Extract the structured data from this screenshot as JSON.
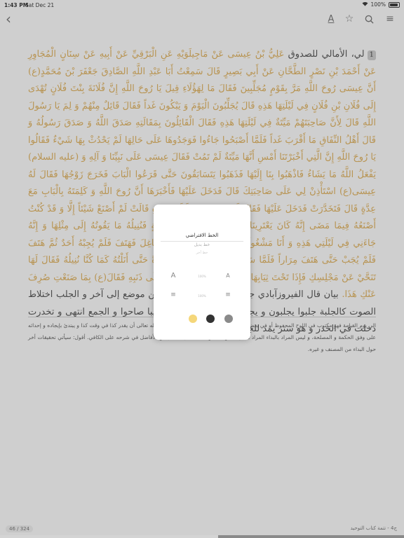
{
  "status_bar": {
    "time": "1:43 PM",
    "date": "Sat Dec 21",
    "battery": "100%"
  },
  "toolbar": {
    "back": "‹",
    "font": "A",
    "bookmark": "☆",
    "search": "⌕",
    "menu": "≡"
  },
  "content": {
    "marker": "1",
    "intro": "لي، الأمالي للصدوق ",
    "quote": "عَلِيُّ بْنُ عِيسَى عَنْ مَاجِيلَوَيْهِ عَنِ الْبَرْقِيِّ عَنْ أَبِيهِ عَنْ سِنَانٍ الْمُجَاوِرِ عَنْ أَحْمَدَ بْنِ نَصْرٍ الطَّحَّانِ عَنْ أَبِي بَصِيرٍ قَالَ سَمِعْتُ أَبَا عَبْدِ اللَّهِ الصَّادِقَ جَعْفَرَ بْنَ مُحَمَّدٍ(ع) أَنَّ عِيسَى رُوحَ اللَّهِ مَرَّ بِقَوْمٍ مُجَلِّبِينَ فَقَالَ مَا لِهَؤُلَاءِ قِيلَ يَا رُوحَ اللَّهِ إِنَّ فُلَانَةَ بِنْتَ فُلَانٍ تُهْدَى إِلَى فُلَانِ بْنِ فُلَانٍ فِي لَيْلَتِهَا هَذِهِ قَالَ يُجَلِّبُونَ الْيَوْمَ وَ يَبْكُونَ غَداً فَقَالَ قَائِلٌ مِنْهُمْ وَ لِمَ يَا رَسُولَ اللَّهِ قَالَ لِأَنَّ صَاحِبَتَهُمْ مَيِّتَةٌ فِي لَيْلَتِهَا هَذِهِ فَقَالَ الْقَائِلُونَ بِمَقَالَتِهِ صَدَقَ اللَّهُ وَ صَدَقَ رَسُولُهُ وَ قَالَ أَهْلُ النِّفَاقِ مَا أَقْرَبَ غَداً فَلَمَّا أَصْبَحُوا جَاءُوا فَوَجَدُوهَا عَلَى حَالِهَا لَمْ يَحْدُثْ بِهَا شَيْءٌ فَقَالُوا يَا رُوحَ اللَّهِ إِنَّ الَّتِي أَخْبَرْتَنَا أَمْسِ أَنَّهَا مَيِّتَةٌ لَمْ تَمُتْ فَقَالَ عِيسَى عَلَى نَبِيِّنَا وَ آلِهِ وَ (عليه السلام) يَفْعَلُ اللَّهُ مَا يَشَاءُ فَاذْهَبُوا بِنَا إِلَيْهَا فَذَهَبُوا يَتَسَابَقُونَ حَتَّى قَرَعُوا الْبَابَ فَخَرَجَ زَوْجُهَا فَقَالَ لَهُ عِيسَى(ع) اسْتَأْذِنْ لِي عَلَى صَاحِبَتِكَ قَالَ فَدَخَلَ عَلَيْهَا فَأَخْبَرَهَا أَنَّ رُوحَ اللَّهِ وَ كَلِمَتَهُ بِالْبَابِ مَعَ عِدَّةٍ قَالَ فَتَخَدَّرَتْ فَدَخَلَ عَلَيْهَا فَقَالَ لَهَا مَا صَنَعْتِ لَيْلَتَكِ هَذِهِ قَالَتْ لَمْ أَصْنَعْ شَيْئاً إِلَّا وَ قَدْ كُنْتُ أَصْنَعُهُ فِيمَا مَضَى إِنَّهُ كَانَ يَعْتَرِينَا سَائِلٌ فِي كُلِّ لَيْلَةِ جُمُعَةٍ فَنُنِيلُهُ مَا يَقُوتُهُ إِلَى مِثْلِهَا وَ إِنَّهُ جَاءَنِي فِي لَيْلَتِي هَذِهِ وَ أَنَا مَشْغُولَةٌ بِأَمْرِي وَ أَهْلِي فِي مَشَاغِلَ فَهَتَفَ فَلَمْ يُجِبْهُ أَحَدٌ ثُمَّ هَتَفَ فَلَمْ يُجَبْ حَتَّى هَتَفَ مِرَاراً فَلَمَّا سَمِعْتُ مَقَالَتَهُ قُمْتُ مُتَنَكِّرَةً حَتَّى أَنَلْتُهُ كَمَا كُنَّا نُنِيلُهُ فَقَالَ لَهَا تَنَحَّيْ عَنْ مَجْلِسِكِ فَإِذَا تَحْتَ ثِيَابِهَا أَفْعَى مِثْلُ جِذْعَةٍ عَاضٌّ عَلَى ذَنَبِهِ فَقَالَ(ع) بِمَا صَنَعْتِ صُرِفَ عَنْكِ هَذَا.",
    "explanation": "بيان قال الفيروزآبادي جلبه يجلبه و يجلبه ساقه من موضع إلى آخر و الجلب اختلاط الصوت كالجلبة جلبوا يجلبون و يجلبون و أجلبوا و جلبوا تجليبا صاحوا و الجمع انتهى و تخدرت دخلت في الخدر و هو ستر يمد للجارية في ناحية البيت"
  },
  "footnotes": "الى يوم القيامة فهو مكتوب في اللوح المحفوظ أو في بعض الكتب السماوية، و من المكتوب و المعلوم له تعالى أن يقدر كذا في وقت كذا و يبتدئ بإيجاده و إحداثه على وفق الحكمة و المصلحة، و ليس المراد بالبداء المراد هنا أيضا من المكتوبات فلتتأمل. قاله بعض الأفاضل في شرحه على الكافي. أقول: سيأتي تحقيقات أخر حول البداء من المصنف و غيره.",
  "footer": {
    "page": "46 / 324",
    "chapter": "ج4 - تتمة كتاب التوحيد",
    "progress_fraction": 0.46
  },
  "popup": {
    "font_default": "الخط الافتراضي",
    "font_alt": "خط بديل",
    "font_alt2": "خط آخر",
    "size_decrease": "A",
    "size_increase": "A",
    "size_value": "100%",
    "spacing_decrease": "≡",
    "spacing_increase": "≡",
    "spacing_value": "100%",
    "themes": [
      {
        "name": "sepia",
        "color": "#f5d77a"
      },
      {
        "name": "dark",
        "color": "#333333"
      },
      {
        "name": "gray",
        "color": "#8a8a8a"
      }
    ]
  }
}
